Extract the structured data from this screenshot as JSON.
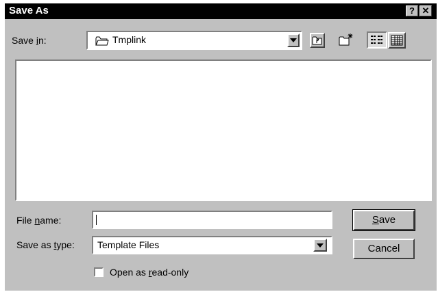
{
  "window": {
    "title": "Save As",
    "help_label": "?",
    "close_label": "✕"
  },
  "location": {
    "label_pre": "Save ",
    "label_key": "i",
    "label_post": "n:",
    "folder": "Tmplink"
  },
  "toolbar": {
    "up_icon": "up-one-level-icon",
    "new_folder_icon": "create-new-folder-icon",
    "list_icon": "list-view-icon",
    "details_icon": "details-view-icon"
  },
  "filename": {
    "label_pre": "File ",
    "label_key": "n",
    "label_post": "ame:",
    "value": ""
  },
  "filetype": {
    "label_pre": "Save as ",
    "label_key": "t",
    "label_post": "ype:",
    "selected": "Template Files"
  },
  "readonly": {
    "label_pre": "Open as ",
    "label_key": "r",
    "label_post": "ead-only",
    "checked": false
  },
  "buttons": {
    "save_key": "S",
    "save_rest": "ave",
    "cancel": "Cancel"
  }
}
